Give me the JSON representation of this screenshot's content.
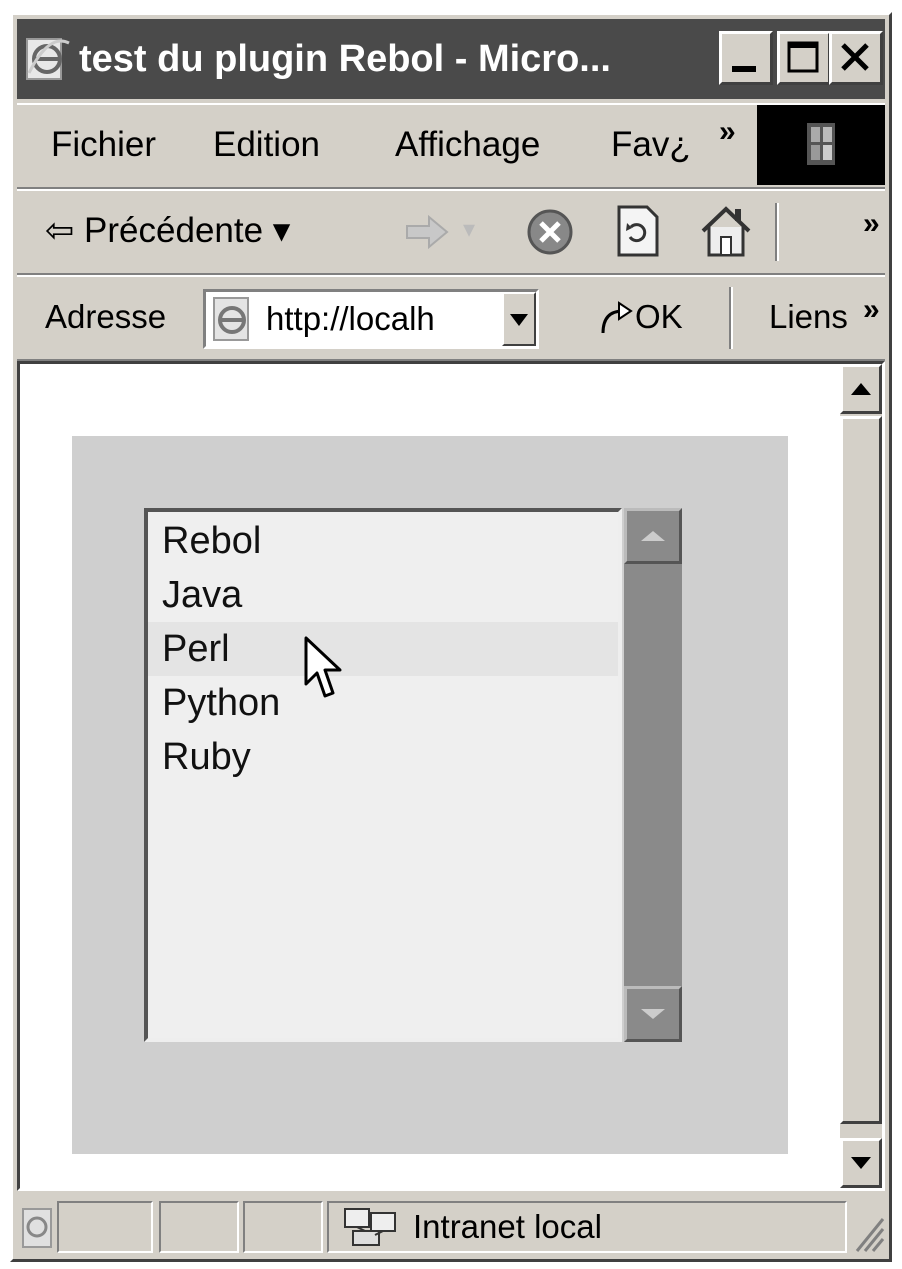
{
  "window": {
    "title": "test du plugin Rebol - Micro..."
  },
  "menubar": {
    "items": [
      "Fichier",
      "Edition",
      "Affichage",
      "Fav¿c"
    ]
  },
  "toolbar": {
    "back_label": "⇦ Précédente ▾"
  },
  "addressbar": {
    "label": "Adresse",
    "url": "http://localh",
    "go_label": "OK",
    "links_label": "Liens"
  },
  "listbox": {
    "items": [
      "Rebol",
      "Java",
      "Perl",
      "Python",
      "Ruby"
    ],
    "hovered_index": 2
  },
  "statusbar": {
    "zone": "Intranet local"
  },
  "icons": [
    "ie-icon",
    "minimize-icon",
    "maximize-icon",
    "close-icon",
    "chevron-icon",
    "windows-logo-icon",
    "back-arrow-icon",
    "forward-arrow-icon",
    "stop-icon",
    "refresh-icon",
    "home-icon",
    "go-arrow-icon",
    "dropdown-arrow-icon",
    "scroll-up-icon",
    "scroll-down-icon",
    "mouse-cursor-icon",
    "intranet-icon"
  ]
}
